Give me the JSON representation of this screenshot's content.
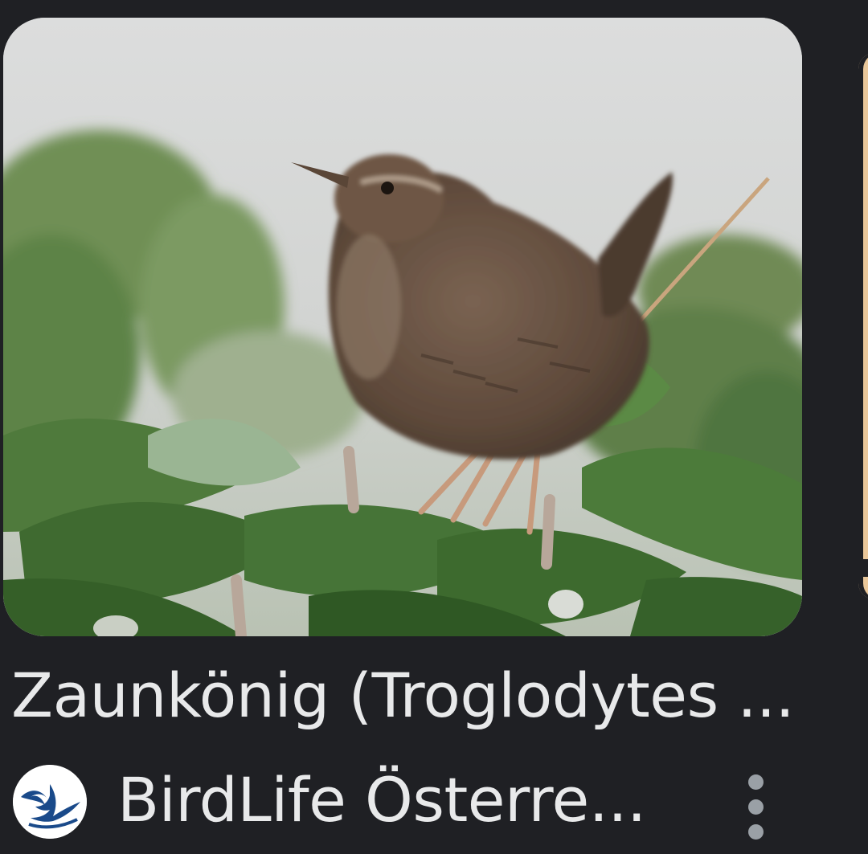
{
  "result": {
    "title": "Zaunkönig (Troglodytes ...",
    "image_subject": "wren-on-leaves",
    "source": {
      "name": "BirdLife Österre...",
      "logo_icon": "birdlife-logo-icon"
    },
    "more_icon": "more-vert-icon"
  },
  "colors": {
    "background": "#1f2024",
    "text": "#e8e9ea",
    "icon": "#9aa0a6",
    "next_card_accent": "#e9c79a"
  }
}
